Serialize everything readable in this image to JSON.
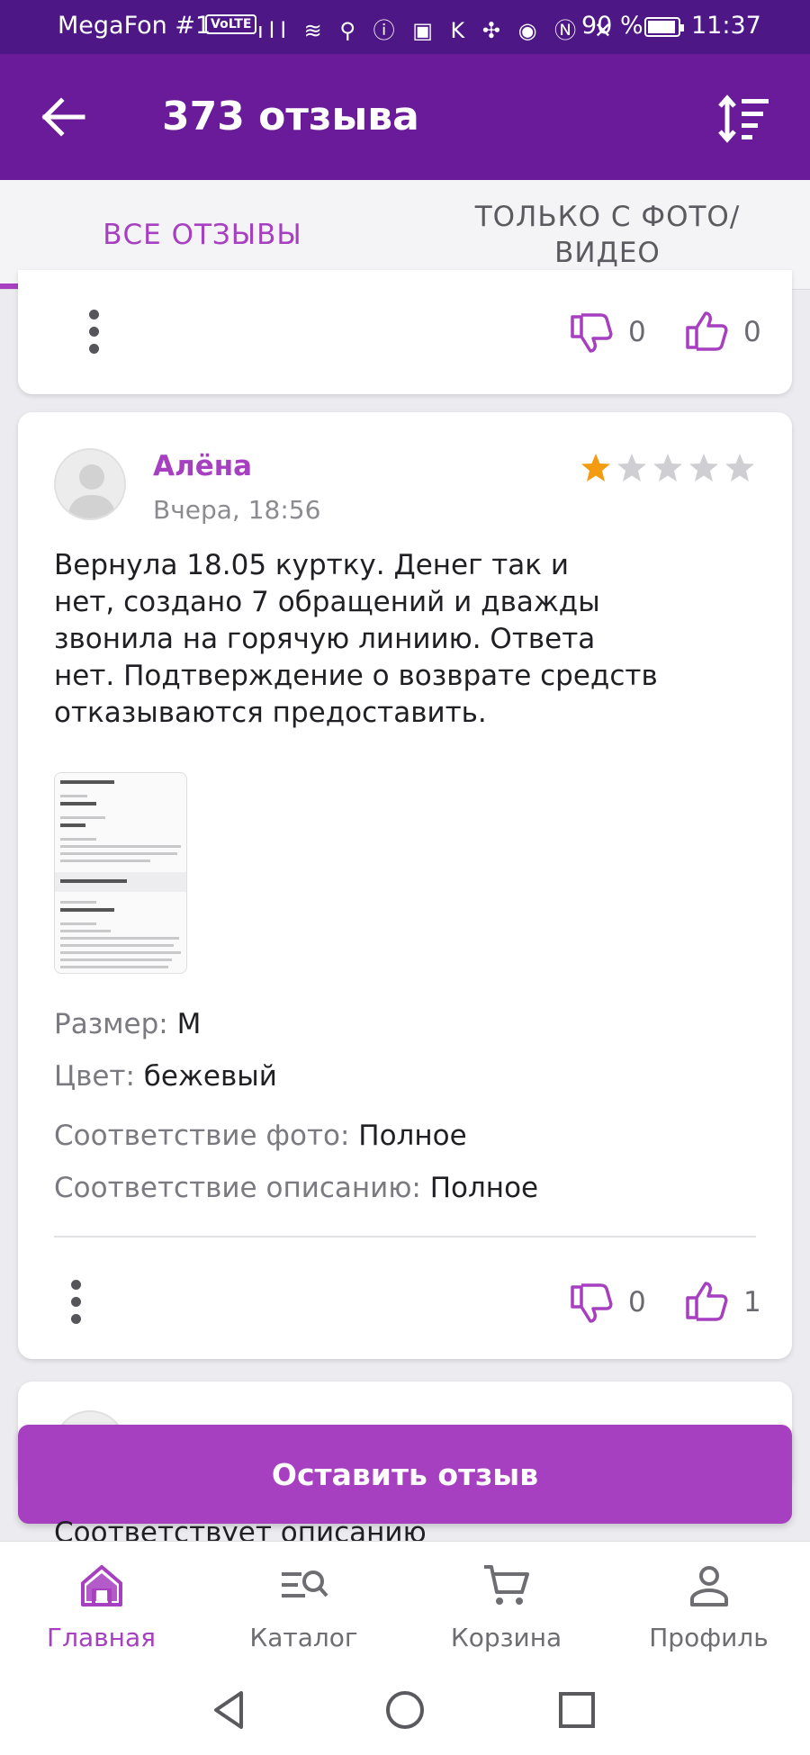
{
  "status_bar": {
    "carrier": "MegaFon #1",
    "volte": "VoLTE",
    "icons": "ıll ≋ ⚲ ⓘ ▣ K ✣ ◉ Ⓝ ✕",
    "battery": "90 %",
    "time": "11:37"
  },
  "header": {
    "title": "373 отзыва",
    "back_icon": "arrow-left-icon",
    "sort_icon": "sort-icon"
  },
  "tabs": [
    {
      "label": "ВСЕ ОТЗЫВЫ",
      "active": true
    },
    {
      "label": "ТОЛЬКО С ФОТО/ ВИДЕО",
      "active": false
    }
  ],
  "prev_card": {
    "dislikes": "0",
    "likes": "0"
  },
  "review": {
    "author": "Алёна",
    "date": "Вчера, 18:56",
    "rating": 1,
    "max_rating": 5,
    "text_lines": [
      "Вернула 18.05 куртку. Денег так и",
      "нет, создано 7 обращений  и дважды",
      "звонила на горячую линиию. Ответа",
      "нет. Подтверждение о возврате средств",
      "отказываются предоставить."
    ],
    "attributes": [
      {
        "label": "Размер: ",
        "value": "M"
      },
      {
        "label": "Цвет: ",
        "value": "бежевый"
      },
      {
        "label": "Соответствие фото: ",
        "value": "Полное"
      },
      {
        "label": "Соответствие описанию: ",
        "value": "Полное"
      }
    ],
    "dislikes": "0",
    "likes": "1"
  },
  "cta": {
    "label": "Оставить отзыв"
  },
  "peek_text": "Соответствует описанию",
  "bottom_nav": [
    {
      "label": "Главная",
      "icon": "home-icon",
      "active": true
    },
    {
      "label": "Каталог",
      "icon": "catalog-search-icon",
      "active": false
    },
    {
      "label": "Корзина",
      "icon": "cart-icon",
      "active": false
    },
    {
      "label": "Профиль",
      "icon": "profile-icon",
      "active": false
    }
  ],
  "colors": {
    "header": "#6a1b9a",
    "accent": "#a63fc0",
    "star_filled": "#f39c12",
    "star_empty": "#cfcfd3"
  }
}
